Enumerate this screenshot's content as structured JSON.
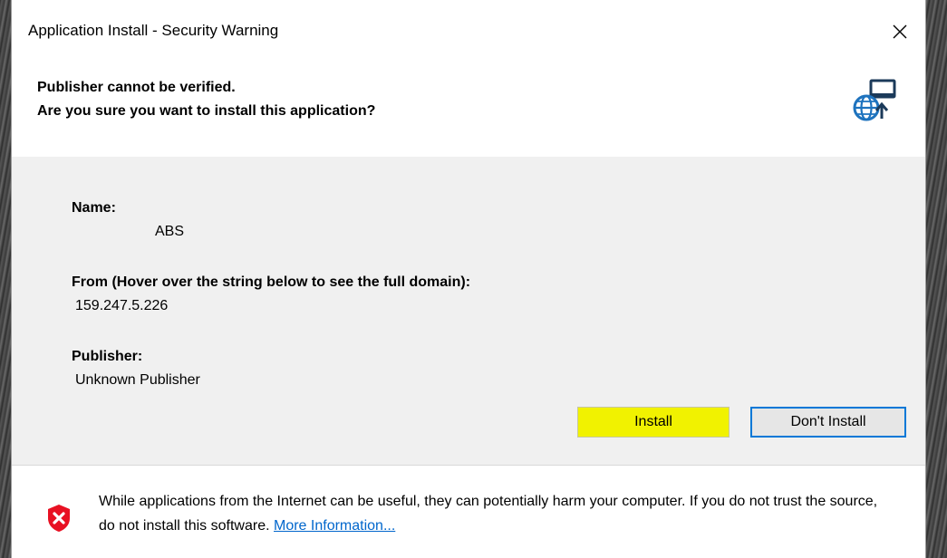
{
  "window": {
    "title": "Application Install - Security Warning",
    "close_glyph": "✕"
  },
  "header": {
    "line1": "Publisher cannot be verified.",
    "line2": "Are you sure you want to install this application?",
    "icon": "globe-install-icon"
  },
  "details": {
    "name_label": "Name:",
    "name_value": "ABS",
    "from_label": "From (Hover over the string below to see the full domain):",
    "from_value": "159.247.5.226",
    "publisher_label": "Publisher:",
    "publisher_value": "Unknown Publisher"
  },
  "buttons": {
    "install": "Install",
    "dont_install": "Don't Install"
  },
  "footer": {
    "warning_text": "While applications from the Internet can be useful, they can potentially harm your computer. If you do not trust the source, do not install this software.",
    "more_info_link": "More Information...",
    "icon": "shield-error-icon"
  },
  "colors": {
    "highlight": "#f1f200",
    "focus_border": "#0078d7",
    "link": "#0066cc",
    "shield": "#e81123"
  }
}
